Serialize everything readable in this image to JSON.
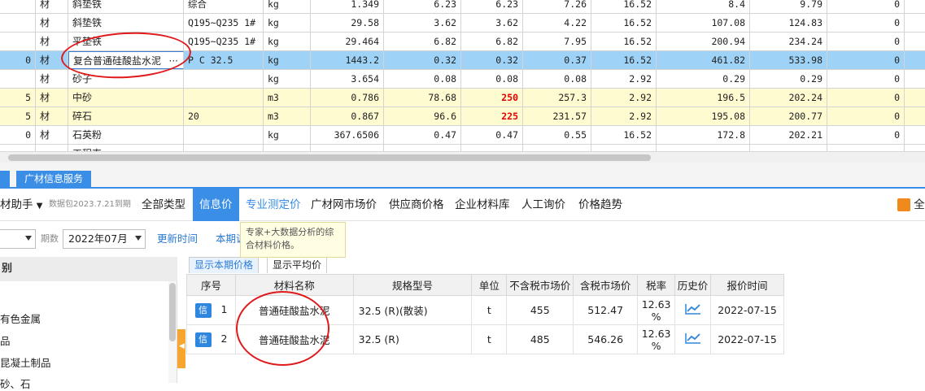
{
  "top_grid": {
    "rows": [
      {
        "idx": "",
        "type": "材",
        "name": "斜垫铁",
        "spec": "综合",
        "unit": "kg",
        "qty": "1.349",
        "p1": "6.23",
        "p2": "6.23",
        "p3": "7.26",
        "tax": "16.52",
        "a1": "8.4",
        "a2": "9.79",
        "z": "0",
        "style": "normal"
      },
      {
        "idx": "",
        "type": "材",
        "name": "斜垫铁",
        "spec": "Q195~Q235 1#",
        "unit": "kg",
        "qty": "29.58",
        "p1": "3.62",
        "p2": "3.62",
        "p3": "4.22",
        "tax": "16.52",
        "a1": "107.08",
        "a2": "124.83",
        "z": "0",
        "style": "normal"
      },
      {
        "idx": "",
        "type": "材",
        "name": "平垫铁",
        "spec": "Q195~Q235 1#",
        "unit": "kg",
        "qty": "29.464",
        "p1": "6.82",
        "p2": "6.82",
        "p3": "7.95",
        "tax": "16.52",
        "a1": "200.94",
        "a2": "234.24",
        "z": "0",
        "style": "normal"
      },
      {
        "idx": "0",
        "type": "材",
        "name": "复合普通硅酸盐水泥",
        "spec": "P C 32.5",
        "unit": "kg",
        "qty": "1443.2",
        "p1": "0.32",
        "p2": "0.32",
        "p3": "0.37",
        "tax": "16.52",
        "a1": "461.82",
        "a2": "533.98",
        "z": "0",
        "style": "sel"
      },
      {
        "idx": "",
        "type": "材",
        "name": "砂子",
        "spec": "",
        "unit": "kg",
        "qty": "3.654",
        "p1": "0.08",
        "p2": "0.08",
        "p3": "0.08",
        "tax": "2.92",
        "a1": "0.29",
        "a2": "0.29",
        "z": "0",
        "style": "normal"
      },
      {
        "idx": "5",
        "type": "材",
        "name": "中砂",
        "spec": "",
        "unit": "m3",
        "qty": "0.786",
        "p1": "78.68",
        "p2": "250",
        "p3": "257.3",
        "tax": "2.92",
        "a1": "196.5",
        "a2": "202.24",
        "z": "0",
        "style": "yel"
      },
      {
        "idx": "5",
        "type": "材",
        "name": "碎石",
        "spec": "20",
        "unit": "m3",
        "qty": "0.867",
        "p1": "96.6",
        "p2": "225",
        "p3": "231.57",
        "tax": "2.92",
        "a1": "195.08",
        "a2": "200.77",
        "z": "0",
        "style": "yel"
      },
      {
        "idx": "0",
        "type": "材",
        "name": "石英粉",
        "spec": "",
        "unit": "kg",
        "qty": "367.6506",
        "p1": "0.47",
        "p2": "0.47",
        "p3": "0.55",
        "tax": "16.52",
        "a1": "172.8",
        "a2": "202.21",
        "z": "0",
        "style": "normal"
      },
      {
        "idx": "",
        "type": "",
        "name": "工程直",
        "spec": "",
        "unit": "",
        "qty": "",
        "p1": "",
        "p2": "",
        "p3": "",
        "tax": "",
        "a1": "",
        "a2": "",
        "z": "",
        "style": "normal"
      }
    ],
    "edit_ellipsis": "···"
  },
  "tabs": {
    "active": "广材信息服务"
  },
  "menu": {
    "assistant": "材助手",
    "package_info": "数据包2023.7.21到期",
    "items": [
      "全部类型",
      "信息价",
      "专业测定价",
      "广材网市场价",
      "供应商价格",
      "企业材料库",
      "人工询价",
      "价格趋势"
    ],
    "right_label": "全"
  },
  "filter": {
    "region_value": "",
    "period_label": "期数",
    "period_value": "2022年07月",
    "update_link": "更新时间",
    "current_link": "本期调"
  },
  "tooltip": {
    "text": "专家+大数据分析的综合材料价格。"
  },
  "left_panel": {
    "header": "别",
    "items": [
      "有色金属",
      "品",
      "昆凝土制品",
      "砂、石"
    ]
  },
  "view_tabs": {
    "current": "显示本期价格",
    "average": "显示平均价"
  },
  "price_table": {
    "headers": [
      "序号",
      "材料名称",
      "规格型号",
      "单位",
      "不含税市场价",
      "含税市场价",
      "税率",
      "历史价",
      "报价时间"
    ],
    "rows": [
      {
        "badge": "信",
        "no": "1",
        "name": "普通硅酸盐水泥",
        "spec": "32.5 (R)(散装)",
        "unit": "t",
        "price_ex": "455",
        "price_in": "512.47",
        "rate": "12.63 %",
        "date": "2022-07-15"
      },
      {
        "badge": "信",
        "no": "2",
        "name": "普通硅酸盐水泥",
        "spec": "32.5 (R)",
        "unit": "t",
        "price_ex": "485",
        "price_in": "546.26",
        "rate": "12.63 %",
        "date": "2022-07-15"
      }
    ]
  },
  "colors": {
    "accent": "#3a8ee6",
    "selected_row": "#9ed3f7",
    "highlight_row": "#fffbd1",
    "red_value": "#e60000",
    "annotation": "#e0191b"
  }
}
